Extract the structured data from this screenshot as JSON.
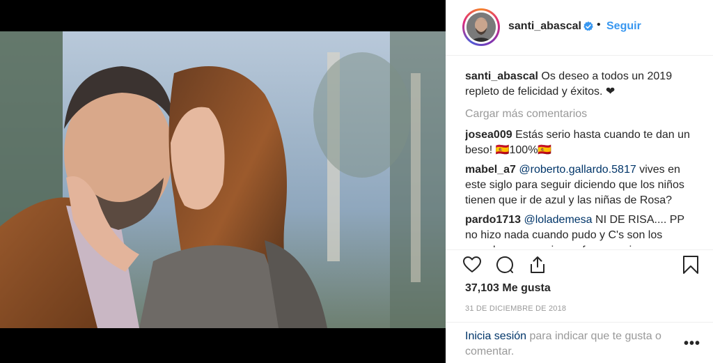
{
  "post": {
    "username": "santi_abascal",
    "follow_label": "Seguir",
    "dot": "•",
    "verified_icon": "verified-badge-icon",
    "caption_user": "santi_abascal",
    "caption_text": "Os deseo a todos un 2019 repleto de felicidad y éxitos. ❤",
    "load_more": "Cargar más comentarios"
  },
  "comments": [
    {
      "user": "josea009",
      "mention": "",
      "text": "Estás serio hasta cuando te dan un beso! 🇪🇸100%🇪🇸"
    },
    {
      "user": "mabel_a7",
      "mention": "@roberto.gallardo.5817",
      "text": "vives en este siglo para seguir diciendo que los niños tienen que ir de azul y las niñas de Rosa?"
    },
    {
      "user": "pardo1713",
      "mention": "@lolademesa",
      "text": "NI DE RISA.... PP no hizo nada cuando pudo y C's son los pamplas.... naranja por fuera y rojo por"
    }
  ],
  "actions": {
    "like_icon": "heart-icon",
    "comment_icon": "comment-icon",
    "share_icon": "share-icon",
    "save_icon": "bookmark-icon"
  },
  "likes": {
    "count": "37,103",
    "word": "Me gusta"
  },
  "date": "31 DE DICIEMBRE DE 2018",
  "footer": {
    "login_link": "Inicia sesión",
    "login_text": " para indicar que te gusta o comentar.",
    "more_label": "•••"
  },
  "colors": {
    "accent": "#3897f0",
    "link": "#003569",
    "muted": "#999999",
    "text": "#262626"
  }
}
